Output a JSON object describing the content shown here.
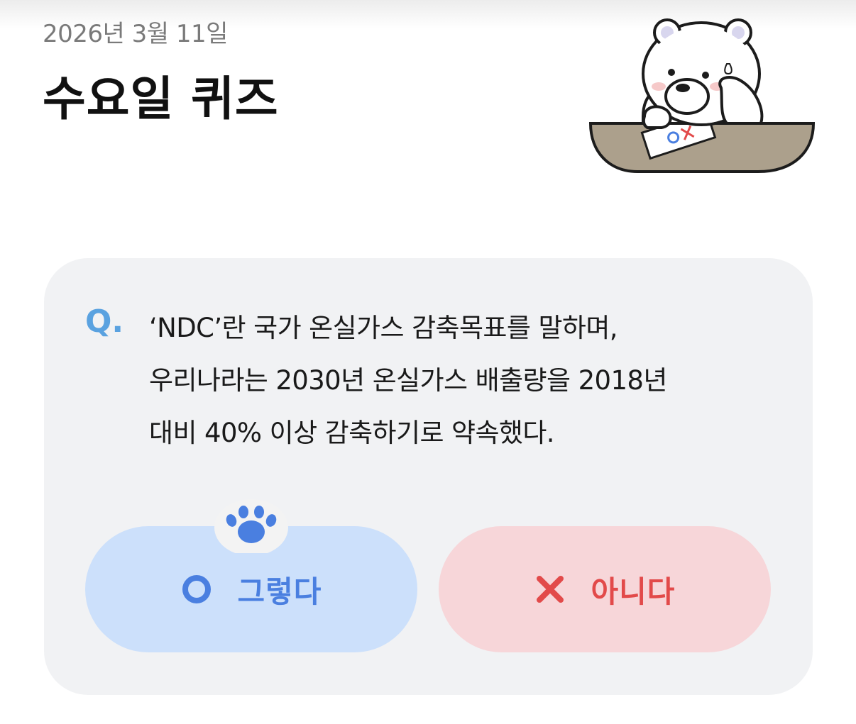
{
  "header": {
    "date": "2026년 3월 11일",
    "title": "수요일 퀴즈"
  },
  "mascot": {
    "icon": "polar-bear-thinking-icon",
    "paper_text": "OX"
  },
  "quiz": {
    "q_marker": "Q.",
    "question_lines": [
      "‘NDC’란 국가 온실가스 감축목표를 말하며,",
      "우리나라는 2030년 온실가스 배출량을 2018년",
      "대비 40% 이상 감축하기로 약속했다."
    ],
    "answers": {
      "yes": {
        "label": "그렇다",
        "icon": "circle-o-icon",
        "color": "#4a7fe0",
        "bg": "#cce0fb"
      },
      "no": {
        "label": "아니다",
        "icon": "x-mark-icon",
        "color": "#e24a4a",
        "bg": "#f7d6d9"
      }
    },
    "selection_marker_icon": "paw-icon"
  },
  "colors": {
    "card_bg": "#f1f2f4",
    "q_marker": "#5aa2e0",
    "date_text": "#7a7a7a"
  }
}
